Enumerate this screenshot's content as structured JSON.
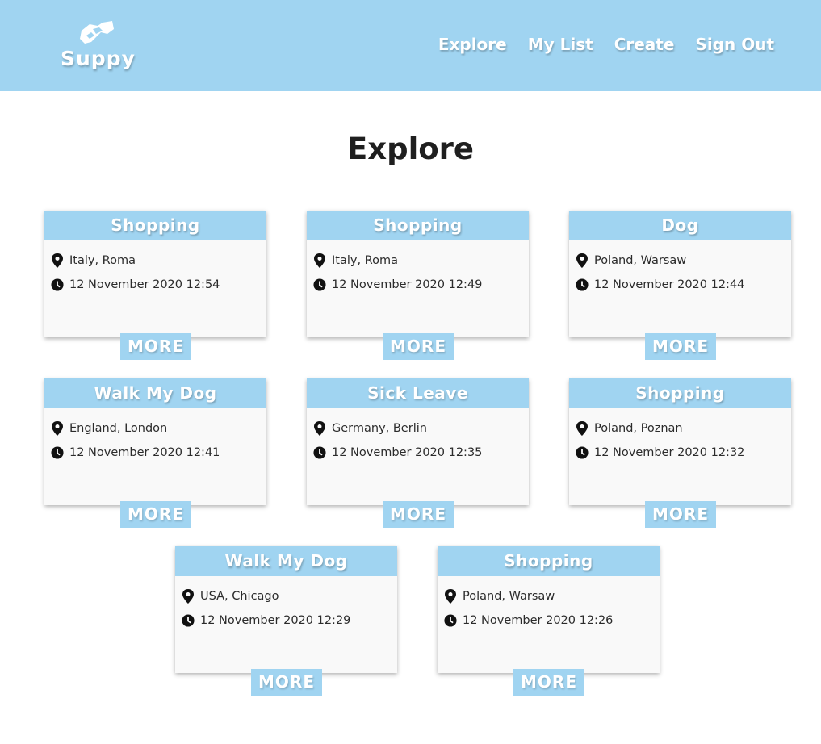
{
  "header": {
    "brand": "Suppy",
    "nav": [
      {
        "label": "Explore"
      },
      {
        "label": "My List"
      },
      {
        "label": "Create"
      },
      {
        "label": "Sign Out"
      }
    ]
  },
  "page": {
    "title": "Explore"
  },
  "colors": {
    "accent": "#a0d4f1",
    "card_bg": "#f9f9f9"
  },
  "cards": [
    {
      "title": "Shopping",
      "location": "Italy, Roma",
      "datetime": "12 November 2020 12:54",
      "button": "MORE"
    },
    {
      "title": "Shopping",
      "location": "Italy, Roma",
      "datetime": "12 November 2020 12:49",
      "button": "MORE"
    },
    {
      "title": "Dog",
      "location": "Poland, Warsaw",
      "datetime": "12 November 2020 12:44",
      "button": "MORE"
    },
    {
      "title": "Walk My Dog",
      "location": "England, London",
      "datetime": "12 November 2020 12:41",
      "button": "MORE"
    },
    {
      "title": "Sick Leave",
      "location": "Germany, Berlin",
      "datetime": "12 November 2020 12:35",
      "button": "MORE"
    },
    {
      "title": "Shopping",
      "location": "Poland, Poznan",
      "datetime": "12 November 2020 12:32",
      "button": "MORE"
    },
    {
      "title": "Walk My Dog",
      "location": "USA, Chicago",
      "datetime": "12 November 2020 12:29",
      "button": "MORE"
    },
    {
      "title": "Shopping",
      "location": "Poland, Warsaw",
      "datetime": "12 November 2020 12:26",
      "button": "MORE"
    }
  ]
}
